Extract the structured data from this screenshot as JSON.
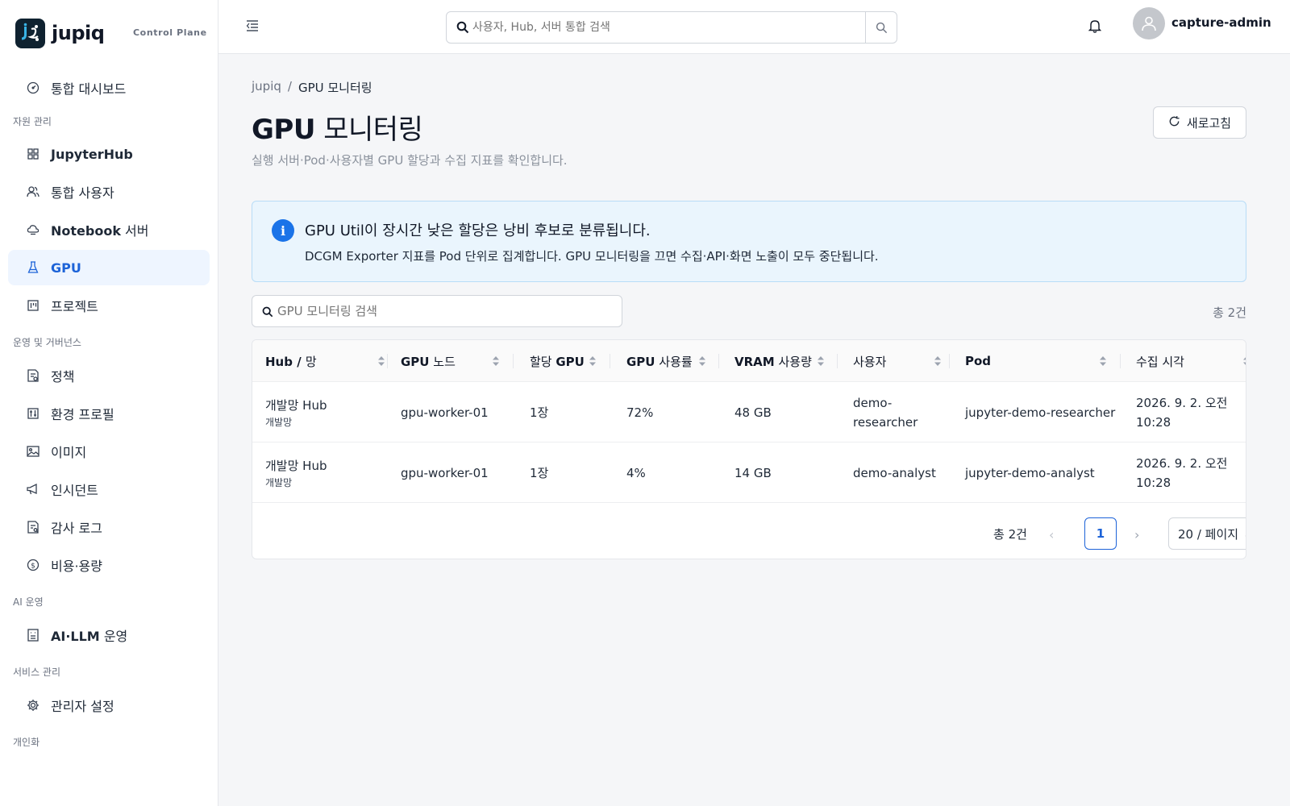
{
  "brand": {
    "name": "jupiq",
    "subtitle": "Control Plane"
  },
  "sidebar": {
    "dashboard": {
      "label": "통합 대시보드",
      "icon": "dashboard-gauge-icon"
    },
    "sections": [
      {
        "title": "자원 관리"
      },
      {
        "title": "운영 및 거버넌스"
      },
      {
        "title": "AI 운영"
      },
      {
        "title": "서비스 관리"
      },
      {
        "title": "개인화"
      }
    ],
    "items": [
      {
        "label": "JupyterHub",
        "icon": "grid-icon"
      },
      {
        "label_bold": "",
        "label": "통합 사용자",
        "icon": "users-icon"
      },
      {
        "label_bold": "Notebook",
        "label": " 서버",
        "icon": "cloud-server-icon"
      },
      {
        "label": "GPU",
        "icon": "flask-icon"
      },
      {
        "label": "프로젝트",
        "icon": "kanban-icon"
      },
      {
        "label": "정책",
        "icon": "policy-doc-icon"
      },
      {
        "label": "환경 프로필",
        "icon": "sliders-icon"
      },
      {
        "label": "이미지",
        "icon": "image-icon"
      },
      {
        "label": "인시던트",
        "icon": "megaphone-icon"
      },
      {
        "label": "감사 로그",
        "icon": "audit-doc-icon"
      },
      {
        "label": "비용·용량",
        "icon": "dollar-circle-icon"
      },
      {
        "label_bold": "AI·LLM",
        "label": " 운영",
        "icon": "robot-icon"
      },
      {
        "label": "관리자 설정",
        "icon": "gear-icon"
      }
    ]
  },
  "header": {
    "search_placeholder": "사용자, Hub, 서버 통합 검색",
    "username": "capture-admin"
  },
  "breadcrumb": {
    "root": "jupiq",
    "sep": "/",
    "current": "GPU 모니터링"
  },
  "page": {
    "title_bold": "GPU",
    "title_rest": " 모니터링",
    "subtitle": "실행 서버·Pod·사용자별 GPU 할당과 수집 지표를 확인합니다.",
    "refresh_label": "새로고침"
  },
  "alert": {
    "title": "GPU Util이 장시간 낮은 할당은 낭비 후보로 분류됩니다.",
    "description": "DCGM Exporter 지표를 Pod 단위로 집계합니다. GPU 모니터링을 끄면 수집·API·화면 노출이 모두 중단됩니다."
  },
  "filter": {
    "placeholder": "GPU 모니터링 검색",
    "total_label": "총 2건"
  },
  "table": {
    "columns": [
      {
        "bold": "Hub / ",
        "rest": "망"
      },
      {
        "bold": "GPU",
        "rest": " 노드"
      },
      {
        "bold": "",
        "rest": "할당 ",
        "bold2": "GPU"
      },
      {
        "bold": "GPU",
        "rest": " 사용률"
      },
      {
        "bold": "VRAM",
        "rest": " 사용량"
      },
      {
        "bold": "",
        "rest": "사용자"
      },
      {
        "bold": "Pod",
        "rest": ""
      },
      {
        "bold": "",
        "rest": "수집 시각"
      }
    ],
    "rows": [
      {
        "hub": "개발망 Hub",
        "network": "개발망",
        "node": "gpu-worker-01",
        "alloc": "1장",
        "util": "72%",
        "vram": "48 GB",
        "user_line1": "demo-",
        "user_line2": "researcher",
        "pod": "jupyter-demo-researcher",
        "time_line1": "2026. 9. 2. 오전",
        "time_line2": "10:28"
      },
      {
        "hub": "개발망 Hub",
        "network": "개발망",
        "node": "gpu-worker-01",
        "alloc": "1장",
        "util": "4%",
        "vram": "14 GB",
        "user_line1": "demo-analyst",
        "user_line2": "",
        "pod": "jupyter-demo-analyst",
        "time_line1": "2026. 9. 2. 오전",
        "time_line2": "10:28"
      }
    ]
  },
  "pagination": {
    "total": "총 2건",
    "current_page": "1",
    "page_size": "20 / 페이지"
  },
  "colors": {
    "accent": "#1d63d8",
    "alert_bg": "#eaf5fd",
    "alert_border": "#b8dcf7",
    "active_nav_bg": "#eef5ff"
  }
}
